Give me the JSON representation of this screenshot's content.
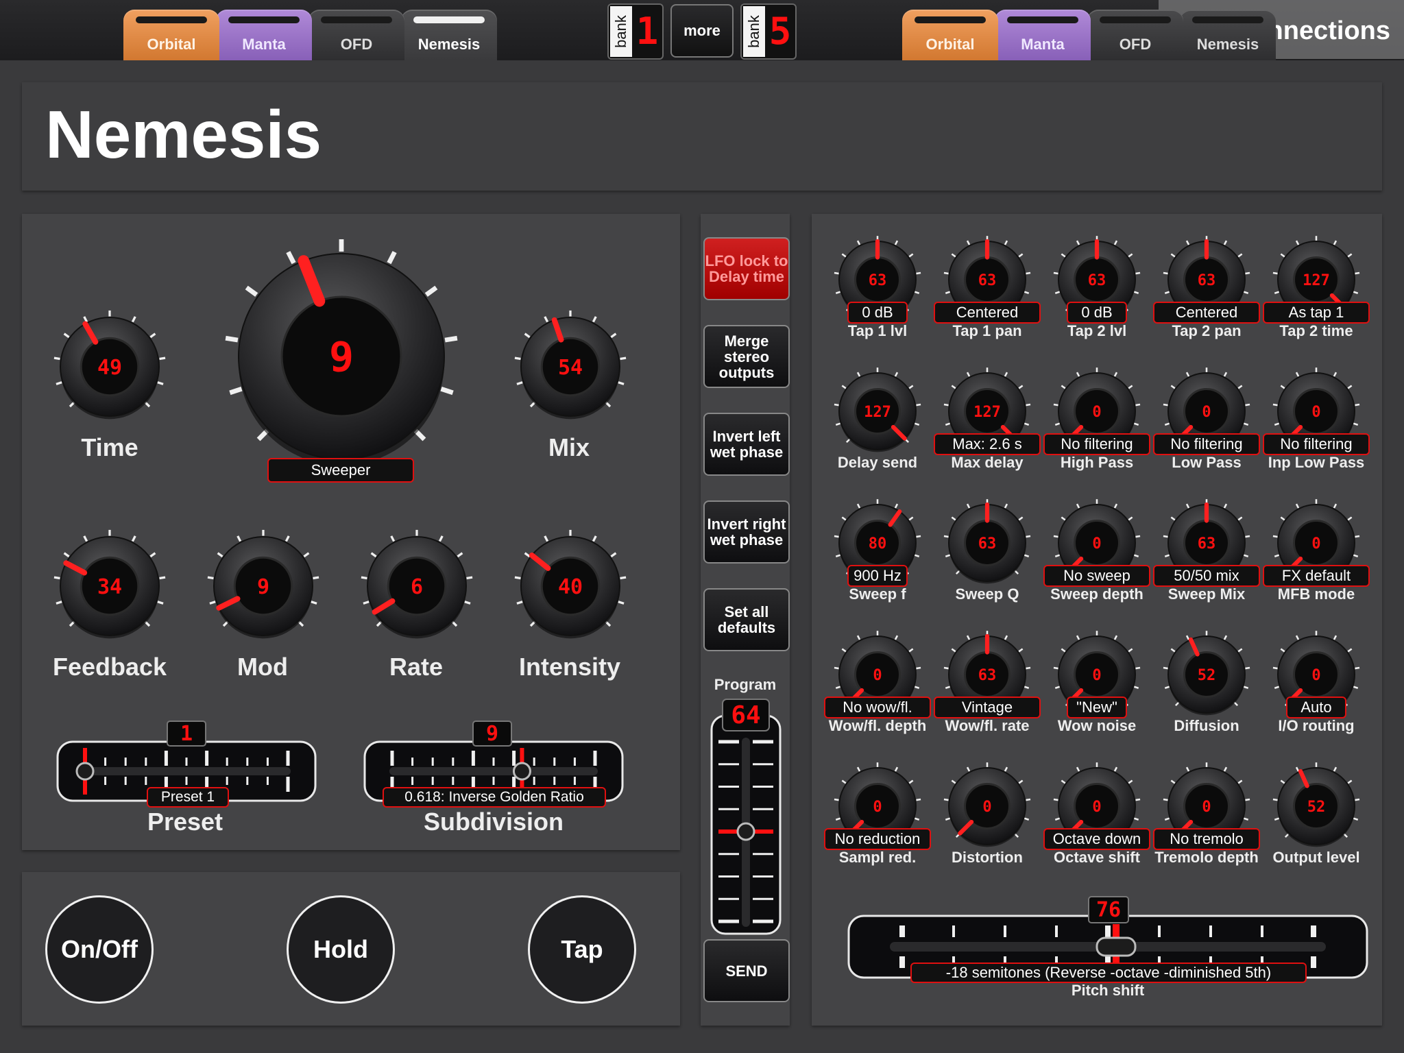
{
  "tabs_left": [
    {
      "label": "Orbital",
      "style": "orbital"
    },
    {
      "label": "Manta",
      "style": "manta"
    },
    {
      "label": "OFD",
      "style": "plain"
    },
    {
      "label": "Nemesis",
      "style": "active"
    }
  ],
  "tabs_right": [
    {
      "label": "Orbital",
      "style": "orbital"
    },
    {
      "label": "Manta",
      "style": "manta"
    },
    {
      "label": "OFD",
      "style": "plain"
    },
    {
      "label": "Nemesis",
      "style": "plain"
    }
  ],
  "bank_left": {
    "label": "bank",
    "digit": "1"
  },
  "bank_right": {
    "label": "bank",
    "digit": "5"
  },
  "more_label": "more",
  "connection_status": "No Connections",
  "title": "Nemesis",
  "big_knobs": [
    {
      "name": "time",
      "label": "Time",
      "value": "49",
      "level": 0.39
    },
    {
      "name": "mode",
      "label": "",
      "value": "9",
      "level": 0.42,
      "display": "Sweeper"
    },
    {
      "name": "mix",
      "label": "Mix",
      "value": "54",
      "level": 0.43
    },
    {
      "name": "feedback",
      "label": "Feedback",
      "value": "34",
      "level": 0.27
    },
    {
      "name": "mod",
      "label": "Mod",
      "value": "9",
      "level": 0.07
    },
    {
      "name": "rate",
      "label": "Rate",
      "value": "6",
      "level": 0.05
    },
    {
      "name": "intensity",
      "label": "Intensity",
      "value": "40",
      "level": 0.31
    }
  ],
  "sliders_left": [
    {
      "name": "preset",
      "label": "Preset",
      "value": "1",
      "display": "Preset 1",
      "level": 0.0
    },
    {
      "name": "subdivision",
      "label": "Subdivision",
      "value": "9",
      "display": "0.618: Inverse Golden Ratio",
      "level": 0.64
    }
  ],
  "buttons_bottom": [
    "On/Off",
    "Hold",
    "Tap"
  ],
  "side_buttons": [
    {
      "label": "LFO lock to Delay time",
      "active": true
    },
    {
      "label": "Merge stereo outputs",
      "active": false
    },
    {
      "label": "Invert left wet phase",
      "active": false
    },
    {
      "label": "Invert right wet phase",
      "active": false
    },
    {
      "label": "Set all defaults",
      "active": false
    }
  ],
  "program": {
    "label": "Program",
    "value": "64",
    "level": 0.5
  },
  "send_label": "SEND",
  "small_knobs": [
    {
      "label": "Tap 1 lvl",
      "value": "63",
      "display": "0 dB",
      "level": 0.5
    },
    {
      "label": "Tap 1 pan",
      "value": "63",
      "display": "Centered",
      "level": 0.5
    },
    {
      "label": "Tap 2 lvl",
      "value": "63",
      "display": "0 dB",
      "level": 0.5
    },
    {
      "label": "Tap 2 pan",
      "value": "63",
      "display": "Centered",
      "level": 0.5
    },
    {
      "label": "Tap 2 time",
      "value": "127",
      "display": "As tap 1",
      "level": 1.0
    },
    {
      "label": "Delay send",
      "value": "127",
      "display": "",
      "level": 1.0
    },
    {
      "label": "Max delay",
      "value": "127",
      "display": "Max: 2.6 s",
      "level": 1.0
    },
    {
      "label": "High Pass",
      "value": "0",
      "display": "No filtering",
      "level": 0.0
    },
    {
      "label": "Low Pass",
      "value": "0",
      "display": "No filtering",
      "level": 0.0
    },
    {
      "label": "Inp Low Pass",
      "value": "0",
      "display": "No filtering",
      "level": 0.0
    },
    {
      "label": "Sweep f",
      "value": "80",
      "display": "900 Hz",
      "level": 0.63
    },
    {
      "label": "Sweep Q",
      "value": "63",
      "display": "",
      "level": 0.5
    },
    {
      "label": "Sweep depth",
      "value": "0",
      "display": "No  sweep",
      "level": 0.0
    },
    {
      "label": "Sweep Mix",
      "value": "63",
      "display": "50/50 mix",
      "level": 0.5
    },
    {
      "label": "MFB mode",
      "value": "0",
      "display": "FX default",
      "level": 0.0
    },
    {
      "label": "Wow/fl. depth",
      "value": "0",
      "display": "No wow/fl.",
      "level": 0.0
    },
    {
      "label": "Wow/fl. rate",
      "value": "63",
      "display": "Vintage",
      "level": 0.5
    },
    {
      "label": "Wow noise",
      "value": "0",
      "display": "\"New\"",
      "level": 0.0
    },
    {
      "label": "Diffusion",
      "value": "52",
      "display": "",
      "level": 0.41
    },
    {
      "label": "I/O routing",
      "value": "0",
      "display": "Auto",
      "level": 0.0
    },
    {
      "label": "Sampl red.",
      "value": "0",
      "display": "No reduction",
      "level": 0.0
    },
    {
      "label": "Distortion",
      "value": "0",
      "display": "",
      "level": 0.0
    },
    {
      "label": "Octave shift",
      "value": "0",
      "display": "Octave down",
      "level": 0.0
    },
    {
      "label": "Tremolo depth",
      "value": "0",
      "display": "No tremolo",
      "level": 0.0
    },
    {
      "label": "Output level",
      "value": "52",
      "display": "",
      "level": 0.41
    }
  ],
  "pitch_slider": {
    "label": "Pitch shift",
    "value": "76",
    "display": "-18 semitones (Reverse -octave -diminished 5th)",
    "level": 0.52
  },
  "colors": {
    "accent_red": "#ff1010",
    "orbital": "#e08a44",
    "manta": "#9c74c8"
  }
}
